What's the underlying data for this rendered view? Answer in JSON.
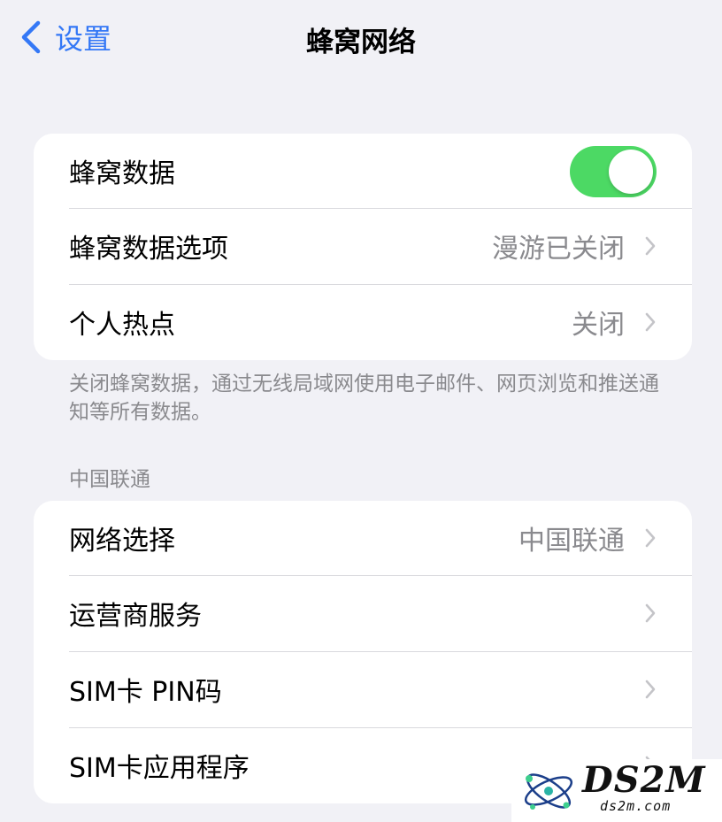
{
  "nav": {
    "back_label": "设置",
    "title": "蜂窝网络"
  },
  "colors": {
    "accent": "#3478f6",
    "toggle_on": "#4cd964",
    "background": "#f1f1f6",
    "secondary_text": "#8a8a8e"
  },
  "group1": {
    "rows": [
      {
        "label": "蜂窝数据",
        "toggle": true
      },
      {
        "label": "蜂窝数据选项",
        "value": "漫游已关闭"
      },
      {
        "label": "个人热点",
        "value": "关闭"
      }
    ],
    "footer": "关闭蜂窝数据，通过无线局域网使用电子邮件、网页浏览和推送通知等所有数据。"
  },
  "section2": {
    "header": "中国联通",
    "rows": [
      {
        "label": "网络选择",
        "value": "中国联通"
      },
      {
        "label": "运营商服务"
      },
      {
        "label": "SIM卡 PIN码"
      },
      {
        "label": "SIM卡应用程序"
      }
    ]
  },
  "watermark": {
    "title": "DS2M",
    "subtitle": "ds2m.com"
  },
  "icons": {
    "back": "chevron-left-icon",
    "disclosure": "chevron-right-icon"
  }
}
